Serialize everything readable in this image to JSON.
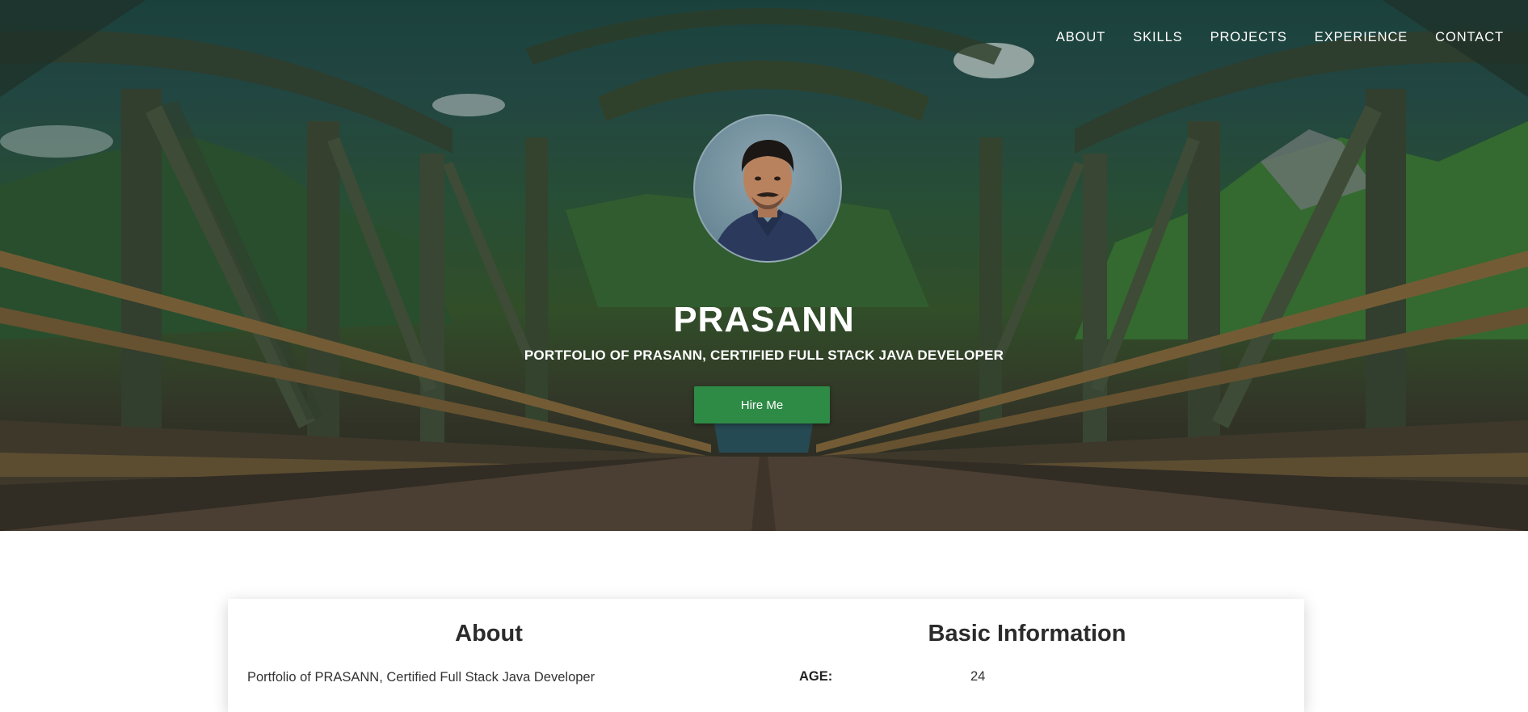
{
  "nav": {
    "items": [
      "ABOUT",
      "SKILLS",
      "PROJECTS",
      "EXPERIENCE",
      "CONTACT"
    ]
  },
  "hero": {
    "name": "PRASANN",
    "subtitle": "PORTFOLIO OF PRASANN, CERTIFIED FULL STACK JAVA DEVELOPER",
    "cta_label": "Hire Me"
  },
  "about": {
    "title": "About",
    "text": "Portfolio of PRASANN, Certified Full Stack Java Developer"
  },
  "basic_info": {
    "title": "Basic Information",
    "rows": [
      {
        "label": "AGE:",
        "value": "24"
      }
    ]
  },
  "colors": {
    "accent": "#2e8b45",
    "hero_dark": "#1f4a45"
  }
}
